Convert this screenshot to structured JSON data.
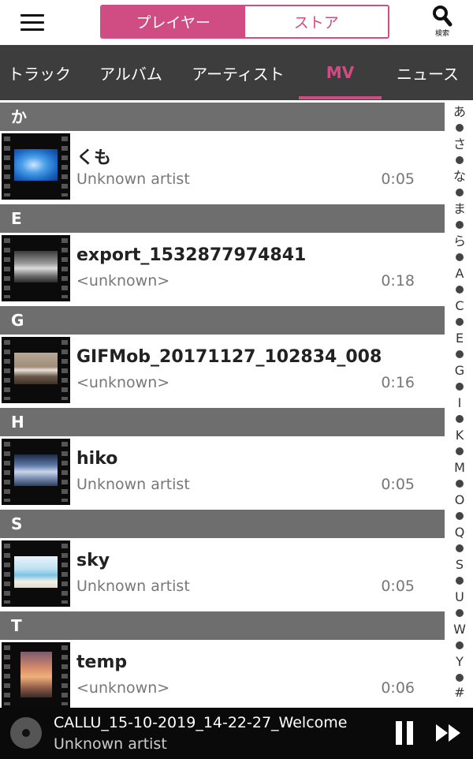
{
  "header": {
    "menu_icon": "hamburger-icon",
    "segments": [
      {
        "label": "プレイヤー",
        "active": true
      },
      {
        "label": "ストア",
        "active": false
      }
    ],
    "search_icon": "search-icon",
    "search_label": "検索"
  },
  "tabs": [
    {
      "label": "トラック"
    },
    {
      "label": "アルバム"
    },
    {
      "label": "アーティスト"
    },
    {
      "label": "MV",
      "active": true
    },
    {
      "label": "ニュース"
    }
  ],
  "sections": [
    {
      "header": "か",
      "items": [
        {
          "title": "くも",
          "subtitle": "Unknown artist",
          "duration": "0:05"
        }
      ]
    },
    {
      "header": "E",
      "items": [
        {
          "title": "export_1532877974841",
          "subtitle": "<unknown>",
          "duration": "0:18"
        }
      ]
    },
    {
      "header": "G",
      "items": [
        {
          "title": "GIFMob_20171127_102834_008",
          "subtitle": "<unknown>",
          "duration": "0:16"
        }
      ]
    },
    {
      "header": "H",
      "items": [
        {
          "title": "hiko",
          "subtitle": "Unknown artist",
          "duration": "0:05"
        }
      ]
    },
    {
      "header": "S",
      "items": [
        {
          "title": "sky",
          "subtitle": "Unknown artist",
          "duration": "0:05"
        }
      ]
    },
    {
      "header": "T",
      "items": [
        {
          "title": "temp",
          "subtitle": "<unknown>",
          "duration": "0:06"
        }
      ]
    }
  ],
  "index": [
    "あ",
    "•",
    "さ",
    "•",
    "な",
    "•",
    "ま",
    "•",
    "ら",
    "•",
    "A",
    "•",
    "C",
    "•",
    "E",
    "•",
    "G",
    "•",
    "I",
    "•",
    "K",
    "•",
    "M",
    "•",
    "O",
    "•",
    "Q",
    "•",
    "S",
    "•",
    "U",
    "•",
    "W",
    "•",
    "Y",
    "•",
    "#"
  ],
  "now_playing": {
    "title": "CALLU_15-10-2019_14-22-27_Welcome",
    "artist": "Unknown artist",
    "disc_icon": "disc-icon",
    "pause_icon": "pause-icon",
    "next_icon": "fast-forward-icon"
  },
  "colors": {
    "accent": "#cf4d82",
    "tabbar": "#3d3d3d",
    "section": "#6e6e6e"
  }
}
